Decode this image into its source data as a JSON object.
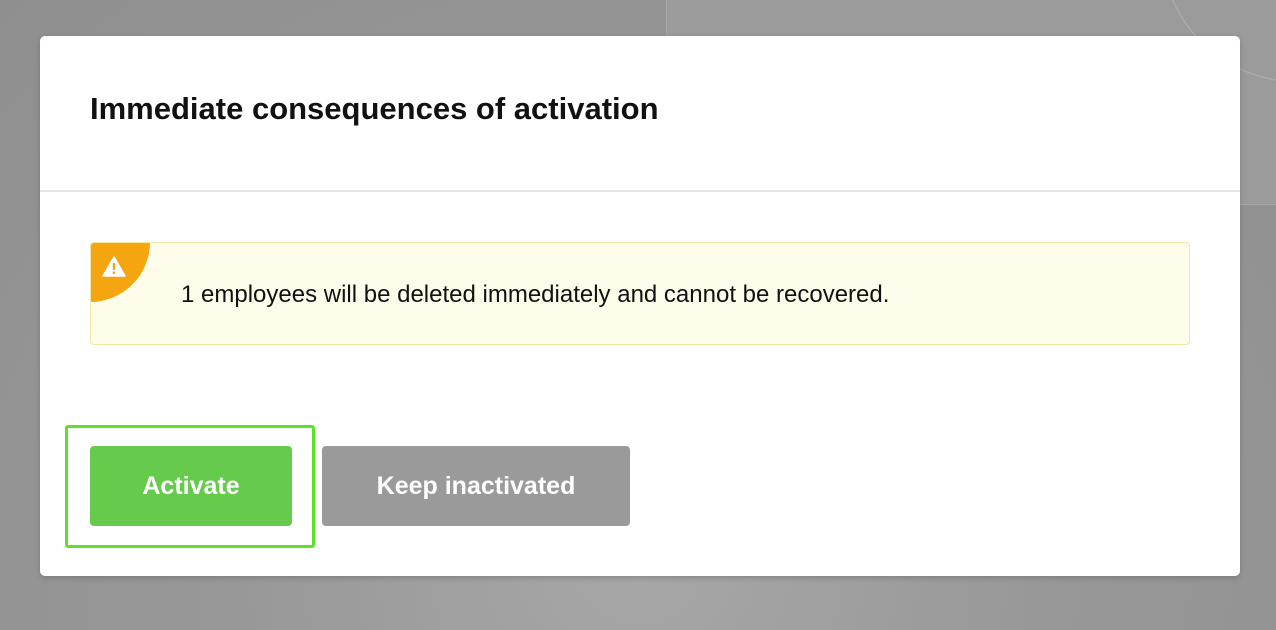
{
  "dialog": {
    "title": "Immediate consequences of activation",
    "warning": {
      "icon": "warning-triangle-icon",
      "message": "1 employees will be deleted immediately and cannot be recovered."
    },
    "buttons": {
      "activate_label": "Activate",
      "keep_label": "Keep inactivated"
    }
  },
  "colors": {
    "activate_button": "#66cb4c",
    "keep_button": "#9a9a9a",
    "warning_accent": "#f5a50f",
    "warning_background": "#fefdeb",
    "focus_ring": "#5fe12a"
  }
}
